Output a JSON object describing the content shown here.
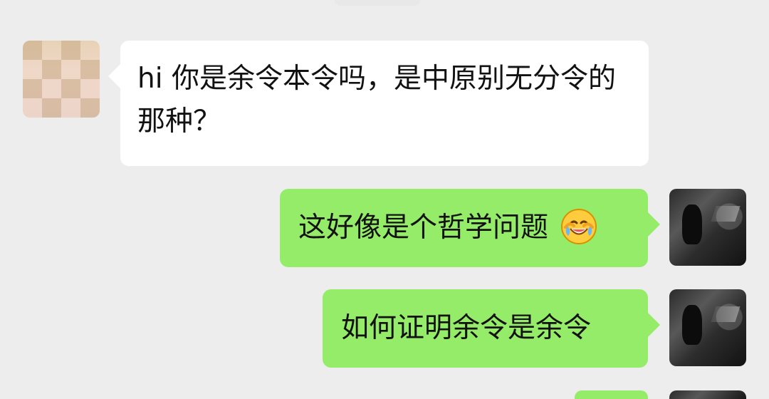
{
  "conversation": {
    "messages": [
      {
        "sender": "other",
        "text": "hi 你是余令本令吗，是中原别无分令的那种？"
      },
      {
        "sender": "self",
        "text": "这好像是个哲学问题"
      },
      {
        "sender": "self",
        "text": "如何证明余令是余令"
      }
    ]
  },
  "icons": {
    "emoji": "crying-laughing-face-emoji",
    "left_avatar": "blurred-profile-avatar",
    "right_avatar": "dark-scene-profile-avatar"
  },
  "colors": {
    "background": "#ededed",
    "incoming_bubble": "#ffffff",
    "outgoing_bubble": "#95ec69",
    "text": "#121212"
  }
}
